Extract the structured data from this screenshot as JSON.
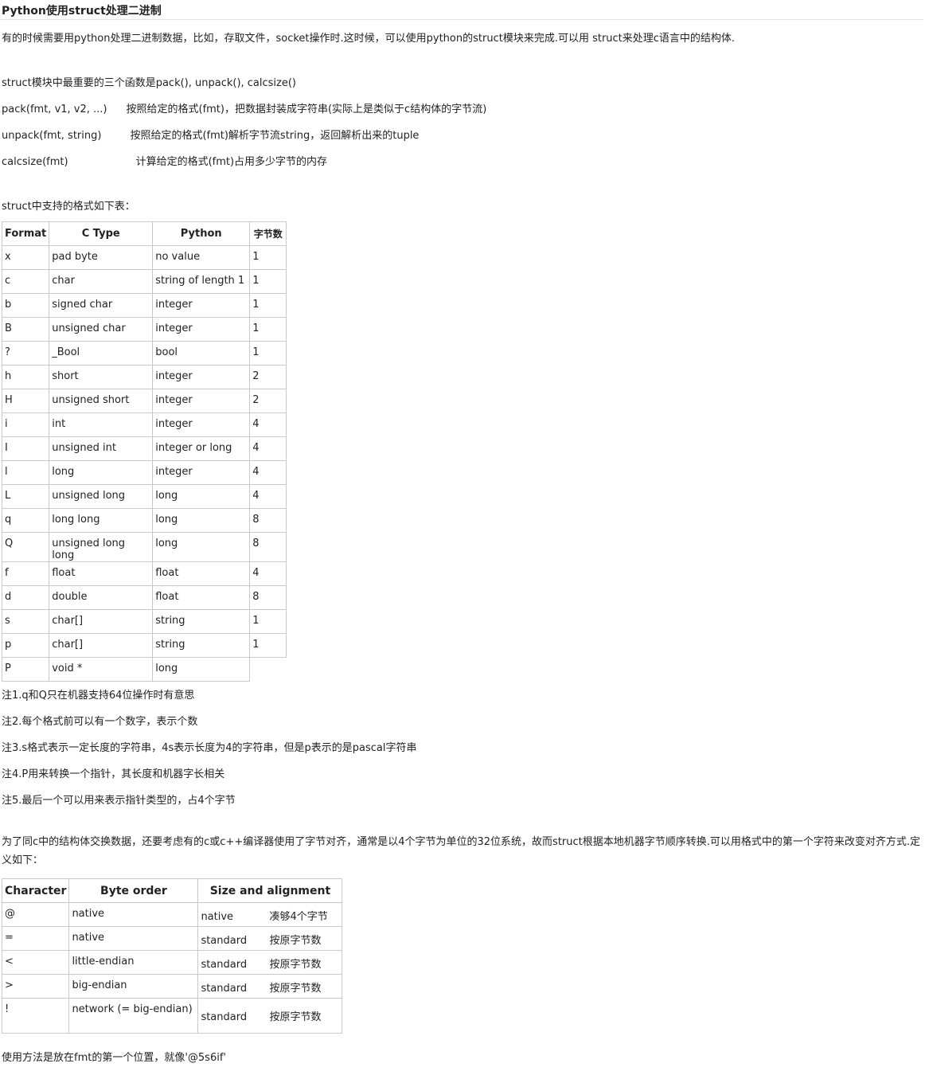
{
  "title": "Python使用struct处理二进制",
  "intro": "有的时候需要用python处理二进制数据，比如，存取文件，socket操作时.这时候，可以使用python的struct模块来完成.可以用 struct来处理c语言中的结构体.",
  "functions": {
    "heading": "struct模块中最重要的三个函数是pack(), unpack(), calcsize()",
    "pack_sig": "pack(fmt, v1, v2, ...)",
    "pack_desc": "按照给定的格式(fmt)，把数据封装成字符串(实际上是类似于c结构体的字节流)",
    "unpack_sig": "unpack(fmt, string)",
    "unpack_desc": "按照给定的格式(fmt)解析字节流string，返回解析出来的tuple",
    "calcsize_sig": "calcsize(fmt)",
    "calcsize_desc": "计算给定的格式(fmt)占用多少字节的内存"
  },
  "format_intro": "struct中支持的格式如下表：",
  "format_table": {
    "headers": [
      "Format",
      "C Type",
      "Python",
      "字节数"
    ],
    "rows": [
      [
        "x",
        "pad byte",
        "no value",
        "1"
      ],
      [
        "c",
        "char",
        "string of length 1",
        "1"
      ],
      [
        "b",
        "signed char",
        "integer",
        "1"
      ],
      [
        "B",
        "unsigned char",
        "integer",
        "1"
      ],
      [
        "?",
        "_Bool",
        "bool",
        "1"
      ],
      [
        "h",
        "short",
        "integer",
        "2"
      ],
      [
        "H",
        "unsigned short",
        "integer",
        "2"
      ],
      [
        "i",
        "int",
        "integer",
        "4"
      ],
      [
        "I",
        "unsigned int",
        "integer or long",
        "4"
      ],
      [
        "l",
        "long",
        "integer",
        "4"
      ],
      [
        "L",
        "unsigned long",
        "long",
        "4"
      ],
      [
        "q",
        "long long",
        "long",
        "8"
      ],
      [
        "Q",
        "unsigned long long",
        "long",
        "8"
      ],
      [
        "f",
        "float",
        "float",
        "4"
      ],
      [
        "d",
        "double",
        "float",
        "8"
      ],
      [
        "s",
        "char[]",
        "string",
        "1"
      ],
      [
        "p",
        "char[]",
        "string",
        "1"
      ],
      [
        "P",
        "void *",
        "long",
        ""
      ]
    ]
  },
  "notes": [
    "注1.q和Q只在机器支持64位操作时有意思",
    "注2.每个格式前可以有一个数字，表示个数",
    "注3.s格式表示一定长度的字符串，4s表示长度为4的字符串，但是p表示的是pascal字符串",
    "注4.P用来转换一个指针，其长度和机器字长相关",
    "注5.最后一个可以用来表示指针类型的，占4个字节"
  ],
  "alignment_intro": "为了同c中的结构体交换数据，还要考虑有的c或c++编译器使用了字节对齐，通常是以4个字节为单位的32位系统，故而struct根据本地机器字节顺序转换.可以用格式中的第一个字符来改变对齐方式.定义如下：",
  "order_table": {
    "headers": [
      "Character",
      "Byte order",
      "Size and alignment"
    ],
    "rows": [
      {
        "char": "@",
        "order": "native",
        "size": "native",
        "note": "凑够4个字节"
      },
      {
        "char": "=",
        "order": "native",
        "size": "standard",
        "note": "按原字节数"
      },
      {
        "char": "<",
        "order": "little-endian",
        "size": "standard",
        "note": "按原字节数"
      },
      {
        "char": ">",
        "order": "big-endian",
        "size": "standard",
        "note": "按原字节数"
      },
      {
        "char": "!",
        "order": "network (= big-endian)",
        "size": "standard",
        "note": "按原字节数"
      }
    ]
  },
  "usage": "使用方法是放在fmt的第一个位置，就像'@5s6if'"
}
